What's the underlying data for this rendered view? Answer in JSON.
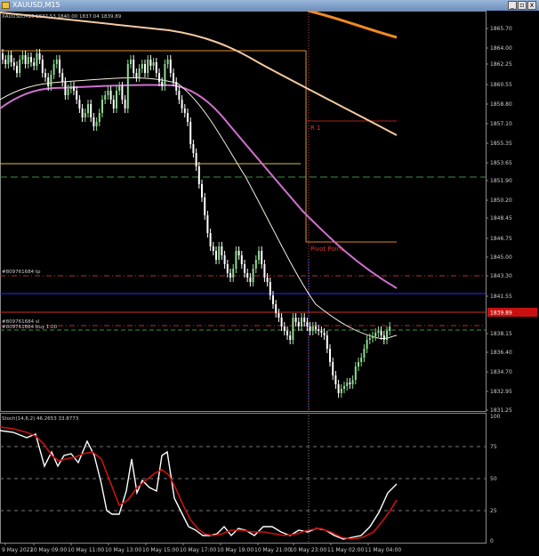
{
  "window": {
    "title": "XAUUSD,M15",
    "minimize_label": "_",
    "restore_label": "▫",
    "close_label": "x"
  },
  "chart_header": {
    "symbol_text": "XAUUSD,M15",
    "ohlc_text": "1837.53 1840.00 1837.04 1839.89"
  },
  "price_axis": {
    "labels": [
      "1865.70",
      "1864.00",
      "1862.25",
      "1860.55",
      "1858.80",
      "1857.10",
      "1855.35",
      "1853.65",
      "1851.90",
      "1850.20",
      "1848.45",
      "1846.75",
      "1845.00",
      "1843.30",
      "1841.55",
      "1838.15",
      "1836.40",
      "1834.70",
      "1832.95",
      "1831.25"
    ],
    "current_price": "1839.89"
  },
  "time_axis": {
    "labels": [
      "9 May 2022",
      "10 May 09:00",
      "10 May 11:00",
      "10 May 13:00",
      "10 May 15:00",
      "10 May 17:00",
      "10 May 19:00",
      "10 May 21:00",
      "10 May 23:00",
      "11 May 02:00",
      "11 May 04:00"
    ]
  },
  "trade_labels": {
    "tp": "#809761684 tp",
    "sl": "#809761684 sl",
    "buy": "#809761684 buy 1.00"
  },
  "pivot_labels": {
    "r1": "R 1",
    "pivot": "Pivot Point"
  },
  "indicator": {
    "label": "Stoch(14,6,2) 46.2653 33.8773",
    "levels": [
      "100",
      "75",
      "50",
      "25",
      "0"
    ]
  },
  "colors": {
    "background": "#000000",
    "bull_candle": "#8fdc8f",
    "bear_candle": "#ffffff",
    "ma_slow": "#f4c9a0",
    "ma_slow_orange": "#f08a20",
    "ma_mid": "#d070d0",
    "ma_fast": "#f5f0e0",
    "stoch_main": "#ffffff",
    "stoch_signal": "#cc1111",
    "green_dashed": "#3f8f3f",
    "red_dashdot": "#b33030",
    "blue_level": "#2a2aff",
    "pivot_orange": "#e08020",
    "r1_red": "#a82020",
    "current_price_marker": "#c81010"
  }
}
